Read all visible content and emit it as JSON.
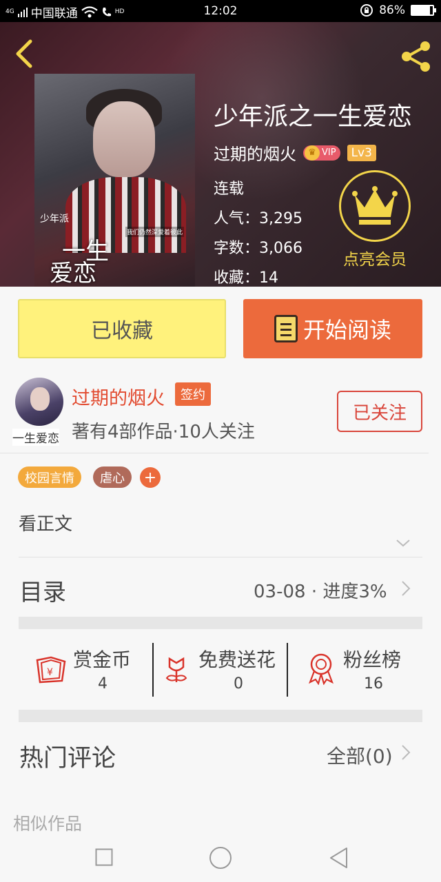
{
  "status_bar": {
    "network": "4G",
    "carrier": "中国联通",
    "hd": "HD",
    "time": "12:02",
    "battery": "86%",
    "battery_level": 0.86
  },
  "book": {
    "title": "少年派之一生爱恋",
    "author": "过期的烟火",
    "vip_label": "VIP",
    "level": "Lv3",
    "status": "连载",
    "popularity": "人气：3,295",
    "word_count": "字数：3,066",
    "favorites": "收藏：14",
    "cover_text": {
      "line1": "少年派",
      "line2": "一生",
      "line3": "爱恋",
      "sub": "我们仍然深爱着彼此"
    }
  },
  "member": {
    "label": "点亮会员"
  },
  "actions": {
    "favorited_label": "已收藏",
    "read_label": "开始阅读"
  },
  "author_card": {
    "name": "过期的烟火",
    "sign_badge": "签约",
    "works": "著有4部作品·10人关注",
    "follow_label": "已关注",
    "avatar_tag": "一生爱恋"
  },
  "tags": [
    {
      "label": "校园言情",
      "color": "#f3a93c"
    },
    {
      "label": "虐心",
      "color": "#b06a5a"
    }
  ],
  "tag_add": "+",
  "read_text": "看正文",
  "toc": {
    "label": "目录",
    "info": "03-08 · 进度3%"
  },
  "stats": [
    {
      "label": "赏金币",
      "value": "4",
      "icon": "red-envelope-icon"
    },
    {
      "label": "免费送花",
      "value": "0",
      "icon": "flower-icon"
    },
    {
      "label": "粉丝榜",
      "value": "16",
      "icon": "medal-icon"
    }
  ],
  "hot_comments": {
    "label": "热门评论",
    "all": "全部(0)"
  },
  "similar_label": "相似作品",
  "colors": {
    "accent": "#ec6a3c",
    "favorite_bg": "#fff27c",
    "member_gold": "#f3d54a",
    "icon_red": "#d9332a"
  }
}
